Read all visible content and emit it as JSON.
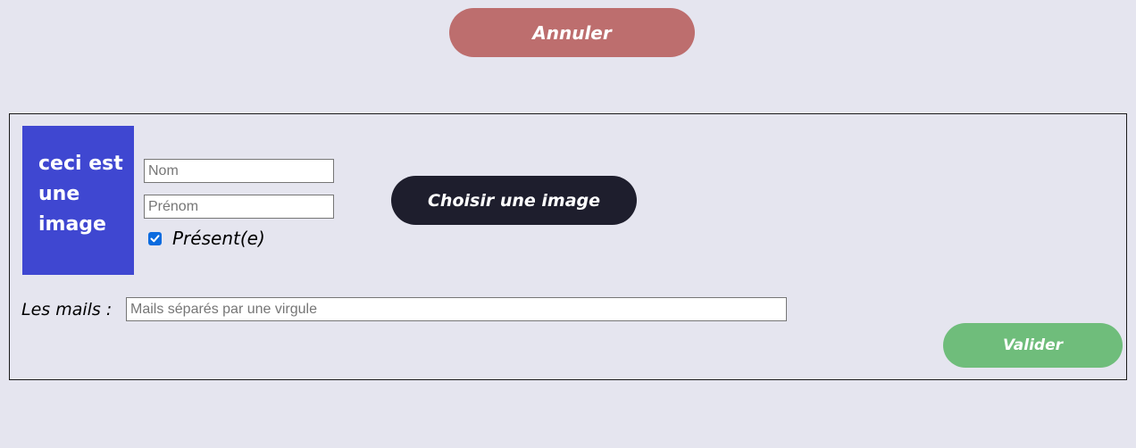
{
  "toolbar": {
    "cancel_label": "Annuler"
  },
  "form": {
    "image_placeholder_text": "ceci est une image",
    "nom_placeholder": "Nom",
    "nom_value": "",
    "prenom_placeholder": "Prénom",
    "prenom_value": "",
    "present_label": "Présent(e)",
    "present_checked": true,
    "choose_image_label": "Choisir une image",
    "mails_label": "Les mails :",
    "mails_placeholder": "Mails séparés par une virgule",
    "mails_value": "",
    "submit_label": "Valider"
  },
  "colors": {
    "background": "#e5e5ef",
    "cancel_button": "#bd6e6e",
    "image_placeholder": "#3f47d1",
    "choose_image_button": "#1e1e2d",
    "submit_button": "#6fbd7b",
    "checkbox_checked": "#0b6bdf"
  }
}
